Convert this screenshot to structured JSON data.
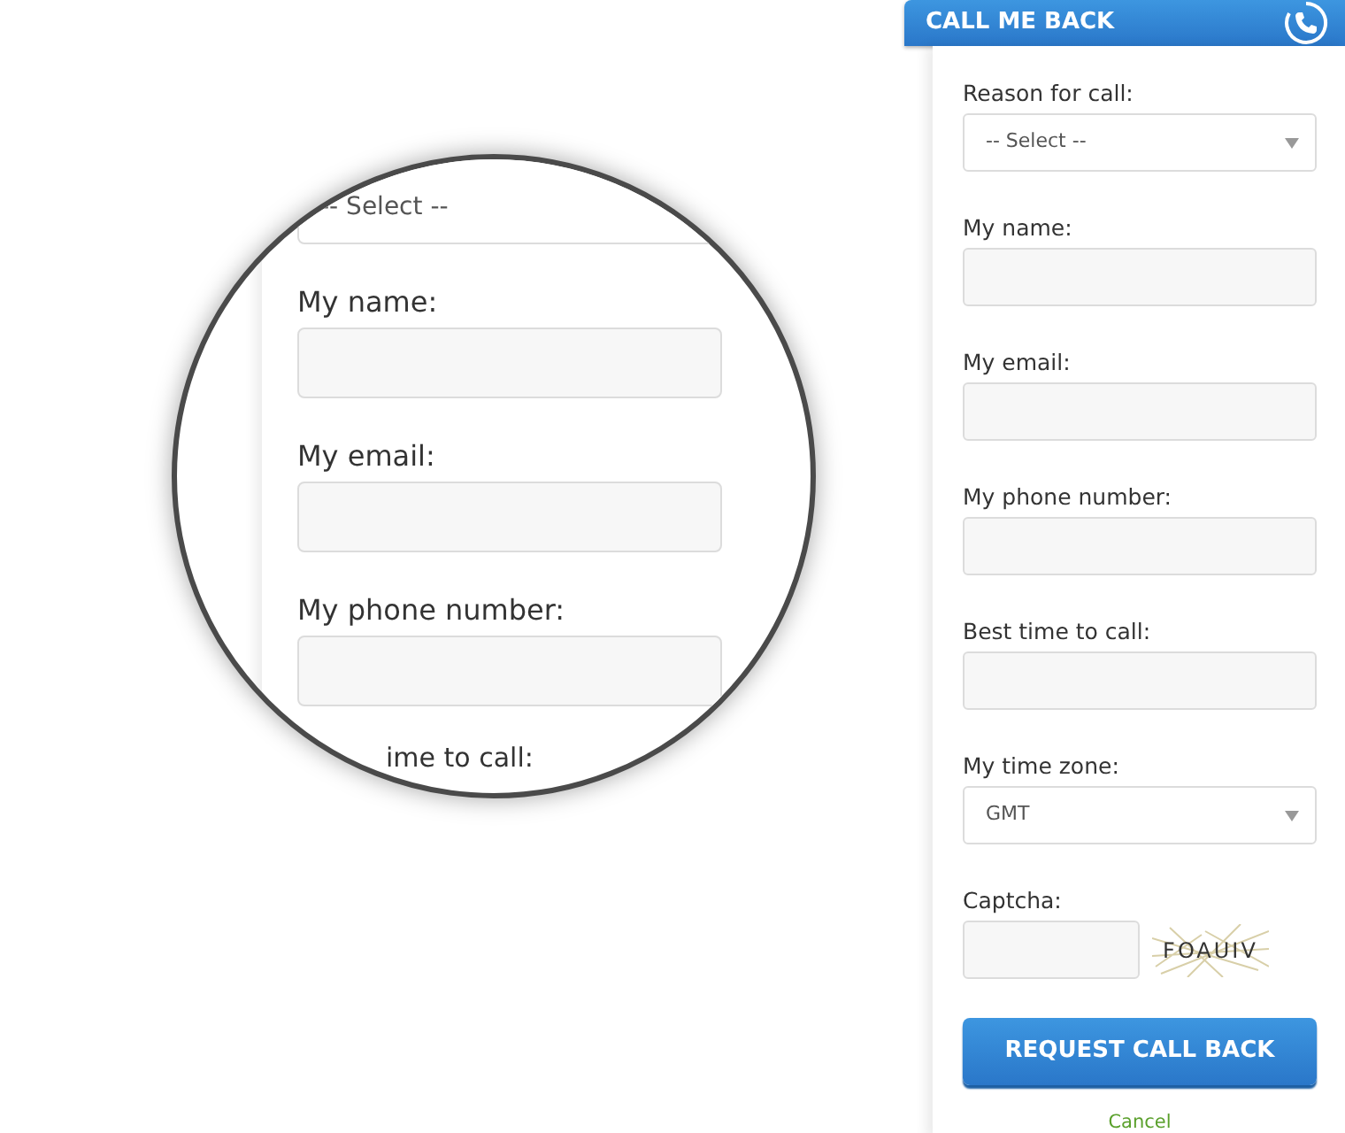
{
  "header": {
    "title": "CALL ME BACK"
  },
  "fields": [
    {
      "kind": "select",
      "label": "Reason for call:",
      "value": "-- Select --"
    },
    {
      "kind": "text",
      "label": "My name:"
    },
    {
      "kind": "text",
      "label": "My email:"
    },
    {
      "kind": "text",
      "label": "My phone number:"
    },
    {
      "kind": "text",
      "label": "Best time to call:"
    },
    {
      "kind": "select",
      "label": "My time zone:",
      "value": "GMT"
    },
    {
      "kind": "captcha",
      "label": "Captcha:",
      "captcha_text": "FOAUIV"
    }
  ],
  "submit": "REQUEST CALL BACK",
  "cancel": "Cancel",
  "magnifier": {
    "select_value": "-- Select --",
    "fields": [
      {
        "label": "My name:"
      },
      {
        "label": "My email:"
      },
      {
        "label": "My phone number:"
      }
    ],
    "cut_label": "ime to call:"
  }
}
